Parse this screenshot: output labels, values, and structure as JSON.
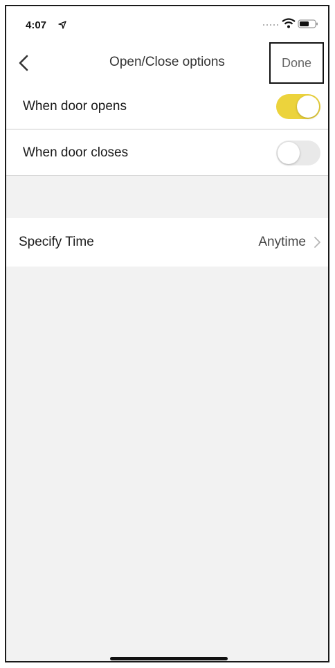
{
  "status_bar": {
    "time": "4:07"
  },
  "nav": {
    "title": "Open/Close options",
    "done_label": "Done"
  },
  "rows": {
    "door_opens": {
      "label": "When door opens",
      "enabled": true
    },
    "door_closes": {
      "label": "When door closes",
      "enabled": false
    },
    "specify_time": {
      "label": "Specify Time",
      "value": "Anytime"
    }
  },
  "colors": {
    "accent": "#ecd33c",
    "background": "#f2f2f2"
  },
  "icons": [
    "location-arrow-icon",
    "signal-dots-icon",
    "wifi-icon",
    "battery-icon",
    "back-chevron-icon",
    "chevron-right-icon"
  ]
}
